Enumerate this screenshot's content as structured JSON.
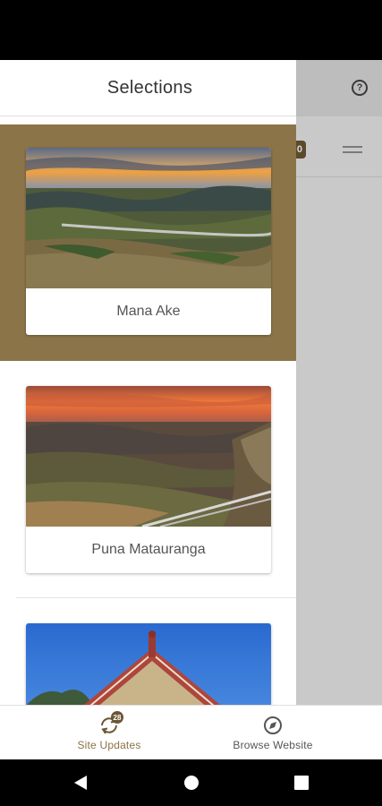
{
  "drawer": {
    "title": "Selections",
    "items": [
      {
        "label": "Mana Ake",
        "active": true
      },
      {
        "label": "Puna Matauranga",
        "active": false
      },
      {
        "label": "",
        "active": false
      }
    ]
  },
  "background": {
    "badge_count": "0"
  },
  "bottom_nav": {
    "items": [
      {
        "label": "Site Updates",
        "icon": "sync-icon",
        "badge": "28"
      },
      {
        "label": "Browse Website",
        "icon": "compass-icon"
      }
    ]
  },
  "colors": {
    "accent": "#8c7449",
    "badge": "#6b5634",
    "scrim": "#c9c9c9"
  }
}
